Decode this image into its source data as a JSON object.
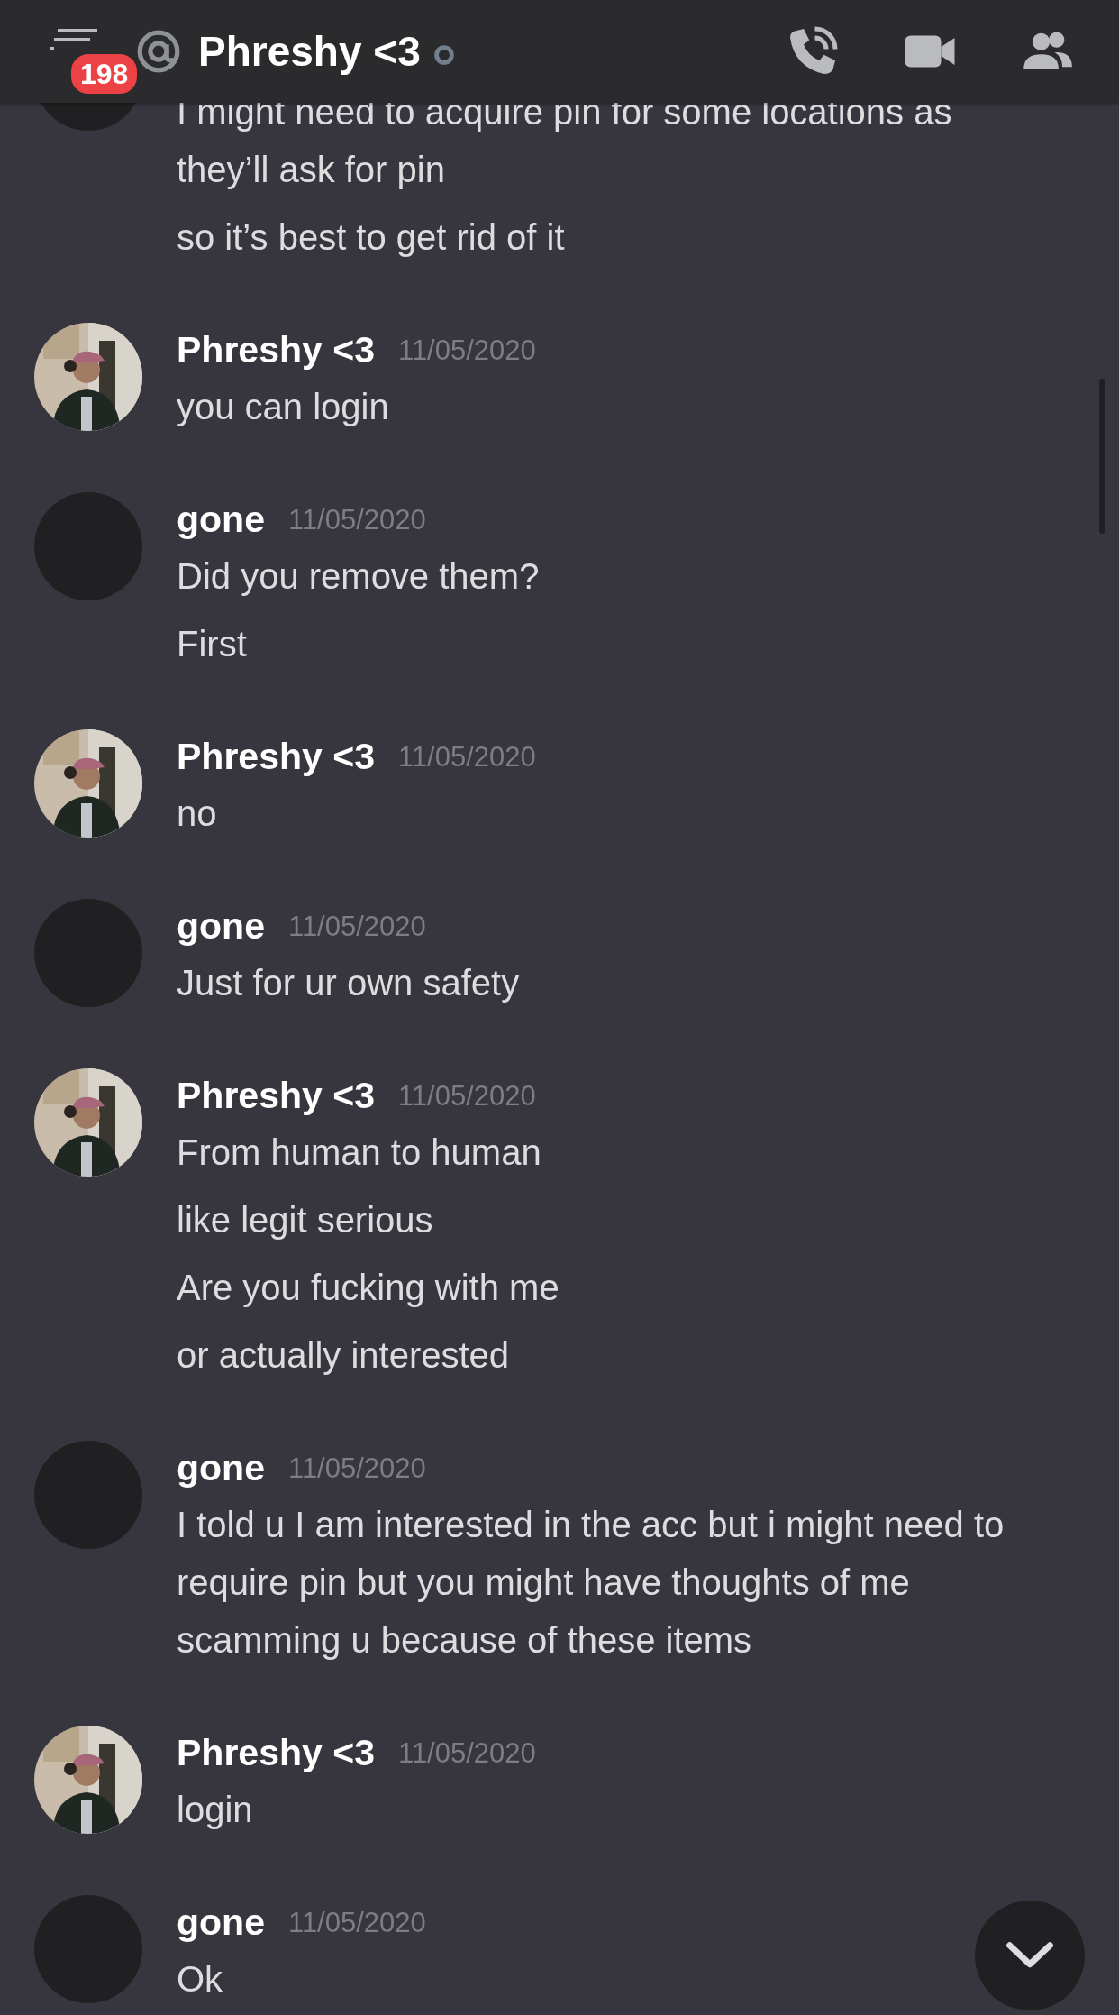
{
  "header": {
    "unread_count": "198",
    "title": "Phreshy <3"
  },
  "messages": [
    {
      "kind": "continued",
      "avatar": {
        "kind": "blank"
      },
      "lines": [
        "I might need to acquire pin for some locations as they’ll ask for pin",
        "so it’s best to get rid of it"
      ]
    },
    {
      "kind": "group",
      "avatar": {
        "kind": "picture"
      },
      "author": "Phreshy <3",
      "timestamp": "11/05/2020",
      "lines": [
        "you can login"
      ]
    },
    {
      "kind": "group",
      "avatar": {
        "kind": "blank"
      },
      "author": "gone",
      "timestamp": "11/05/2020",
      "lines": [
        "Did you remove them?",
        "First"
      ]
    },
    {
      "kind": "group",
      "avatar": {
        "kind": "picture"
      },
      "author": "Phreshy <3",
      "timestamp": "11/05/2020",
      "lines": [
        "no"
      ]
    },
    {
      "kind": "group",
      "avatar": {
        "kind": "blank"
      },
      "author": "gone",
      "timestamp": "11/05/2020",
      "lines": [
        "Just for ur own safety"
      ]
    },
    {
      "kind": "group",
      "avatar": {
        "kind": "picture"
      },
      "author": "Phreshy <3",
      "timestamp": "11/05/2020",
      "lines": [
        "From human to human",
        "like legit serious",
        "Are you fucking with me",
        "or actually interested"
      ]
    },
    {
      "kind": "group",
      "avatar": {
        "kind": "blank"
      },
      "author": "gone",
      "timestamp": "11/05/2020",
      "lines": [
        "I told u I am interested in the acc but i might need to require pin but you might have thoughts of me scamming u because of these items"
      ]
    },
    {
      "kind": "group",
      "avatar": {
        "kind": "picture"
      },
      "author": "Phreshy <3",
      "timestamp": "11/05/2020",
      "lines": [
        "login"
      ]
    },
    {
      "kind": "group",
      "avatar": {
        "kind": "blank"
      },
      "author": "gone",
      "timestamp": "11/05/2020",
      "lines": [
        "Ok"
      ]
    }
  ]
}
